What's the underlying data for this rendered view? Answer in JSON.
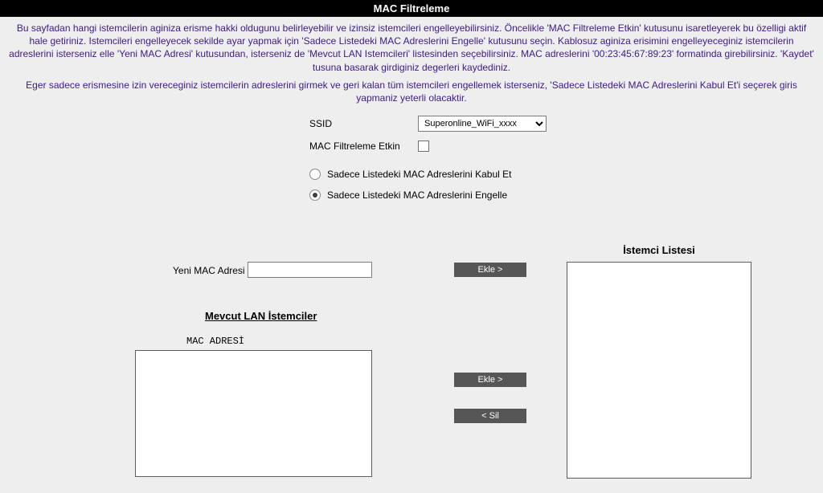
{
  "header": {
    "title": "MAC Filtreleme"
  },
  "intro": {
    "p1": "Bu sayfadan hangi istemcilerin aginiza erisme hakki oldugunu belirleyebilir ve izinsiz istemcileri engelleyebilirsiniz. Öncelikle 'MAC Filtreleme Etkin' kutusunu isaretleyerek bu özelligi aktif hale getiriniz. Istemcileri engelleyecek sekilde ayar yapmak için 'Sadece Listedeki MAC Adreslerini Engelle' kutusunu seçin. Kablosuz aginiza erisimini engelleyeceginiz istemcilerin adreslerini isterseniz elle 'Yeni MAC Adresi' kutusundan, isterseniz de 'Mevcut LAN Istemcileri' listesinden seçebilirsiniz. MAC adreslerini '00:23:45:67:89:23' formatinda girebilirsiniz. 'Kaydet' tusuna basarak girdiginiz degerleri kaydediniz.",
    "p2": "Eger sadece erismesine izin vereceginiz istemcilerin adreslerini girmek ve geri kalan tüm istemcileri engellemek isterseniz, 'Sadece Listedeki MAC Adreslerini Kabul Et'i seçerek giris yapmaniz yeterli olacaktir."
  },
  "settings": {
    "ssid_label": "SSID",
    "ssid_selected": "Superonline_WiFi_xxxx",
    "mac_filter_label": "MAC Filtreleme Etkin",
    "mac_filter_checked": false,
    "radio_allow": "Sadece Listedeki MAC Adreslerini Kabul Et",
    "radio_deny": "Sadece Listedeki MAC Adreslerini Engelle",
    "radio_selected": "deny"
  },
  "lists": {
    "client_list_title": "İstemci Listesi",
    "client_list_items": [],
    "new_mac_label": "Yeni MAC Adresi",
    "new_mac_value": "",
    "lan_clients_title": "Mevcut LAN İstemciler",
    "mac_adresi_header": "MAC ADRESİ",
    "lan_client_items": []
  },
  "buttons": {
    "add": "Ekle >",
    "delete": "< Sil"
  }
}
